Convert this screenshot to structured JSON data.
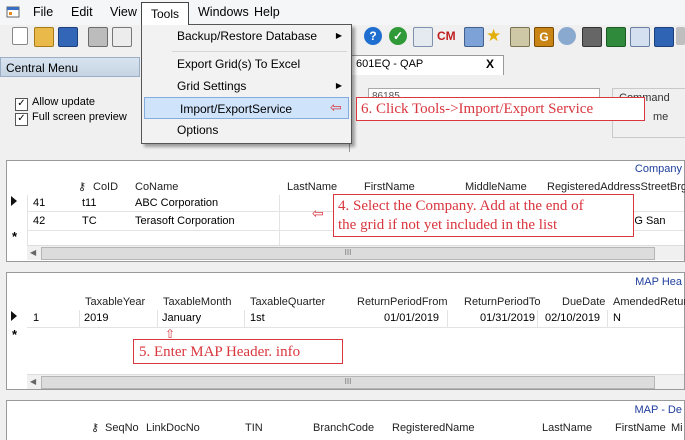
{
  "menubar": {
    "items": [
      "File",
      "Edit",
      "View",
      "Tools",
      "Windows",
      "Help"
    ]
  },
  "tools_menu": {
    "items": [
      {
        "label": "Backup/Restore Database",
        "submenu": true
      },
      {
        "label": "Export Grid(s) To Excel",
        "submenu": false
      },
      {
        "label": "Grid Settings",
        "submenu": true
      },
      {
        "label": "Import/ExportService",
        "submenu": false
      },
      {
        "label": "Options",
        "submenu": false
      }
    ]
  },
  "central_menu": {
    "title": "Central Menu",
    "allow_update": "Allow update",
    "full_screen_preview": "Full screen preview"
  },
  "document_tab": {
    "title": "601EQ - QAP",
    "close_glyph": "X",
    "tin_partial": "86185",
    "command_label": "Command",
    "name_partial": "me"
  },
  "company_grid": {
    "title": "Company",
    "key_glyph": "⚷",
    "headers": [
      "CoID",
      "CoName",
      "LastName",
      "FirstName",
      "MiddleName",
      "RegisteredAddressStreetBrgy"
    ],
    "rows": [
      {
        "id": "41",
        "coid": "t11",
        "coname": "ABC Corporation",
        "address": ""
      },
      {
        "id": "42",
        "coid": "TC",
        "coname": "Terasoft Corporation",
        "address": "SG San"
      }
    ]
  },
  "map_header_grid": {
    "title": "MAP Hea",
    "headers": [
      "TaxableYear",
      "TaxableMonth",
      "TaxableQuarter",
      "ReturnPeriodFrom",
      "ReturnPeriodTo",
      "DueDate",
      "AmendedRetur"
    ],
    "rows": [
      {
        "id": "1",
        "year": "2019",
        "month": "January",
        "quarter": "1st",
        "from": "01/01/2019",
        "to": "01/31/2019",
        "due": "02/10/2019",
        "amended": "N"
      }
    ]
  },
  "map_detail_grid": {
    "title": "MAP - De",
    "headers": [
      "SeqNo",
      "LinkDocNo",
      "TIN",
      "BranchCode",
      "RegisteredName",
      "LastName",
      "FirstName",
      "Mi"
    ]
  },
  "annotations": {
    "step6": "6. Click Tools->Import/Export Service",
    "step4_line1": "4. Select the Company. Add at the end of",
    "step4_line2": "the grid if not yet included in the list",
    "step5": "5. Enter MAP Header. info"
  },
  "scroll_thumb": "III",
  "new_row_glyph": "*",
  "colors": {
    "annotation": "#d9363e",
    "panel_title": "#1e3e9c",
    "highlight": "#cfe3fb"
  }
}
